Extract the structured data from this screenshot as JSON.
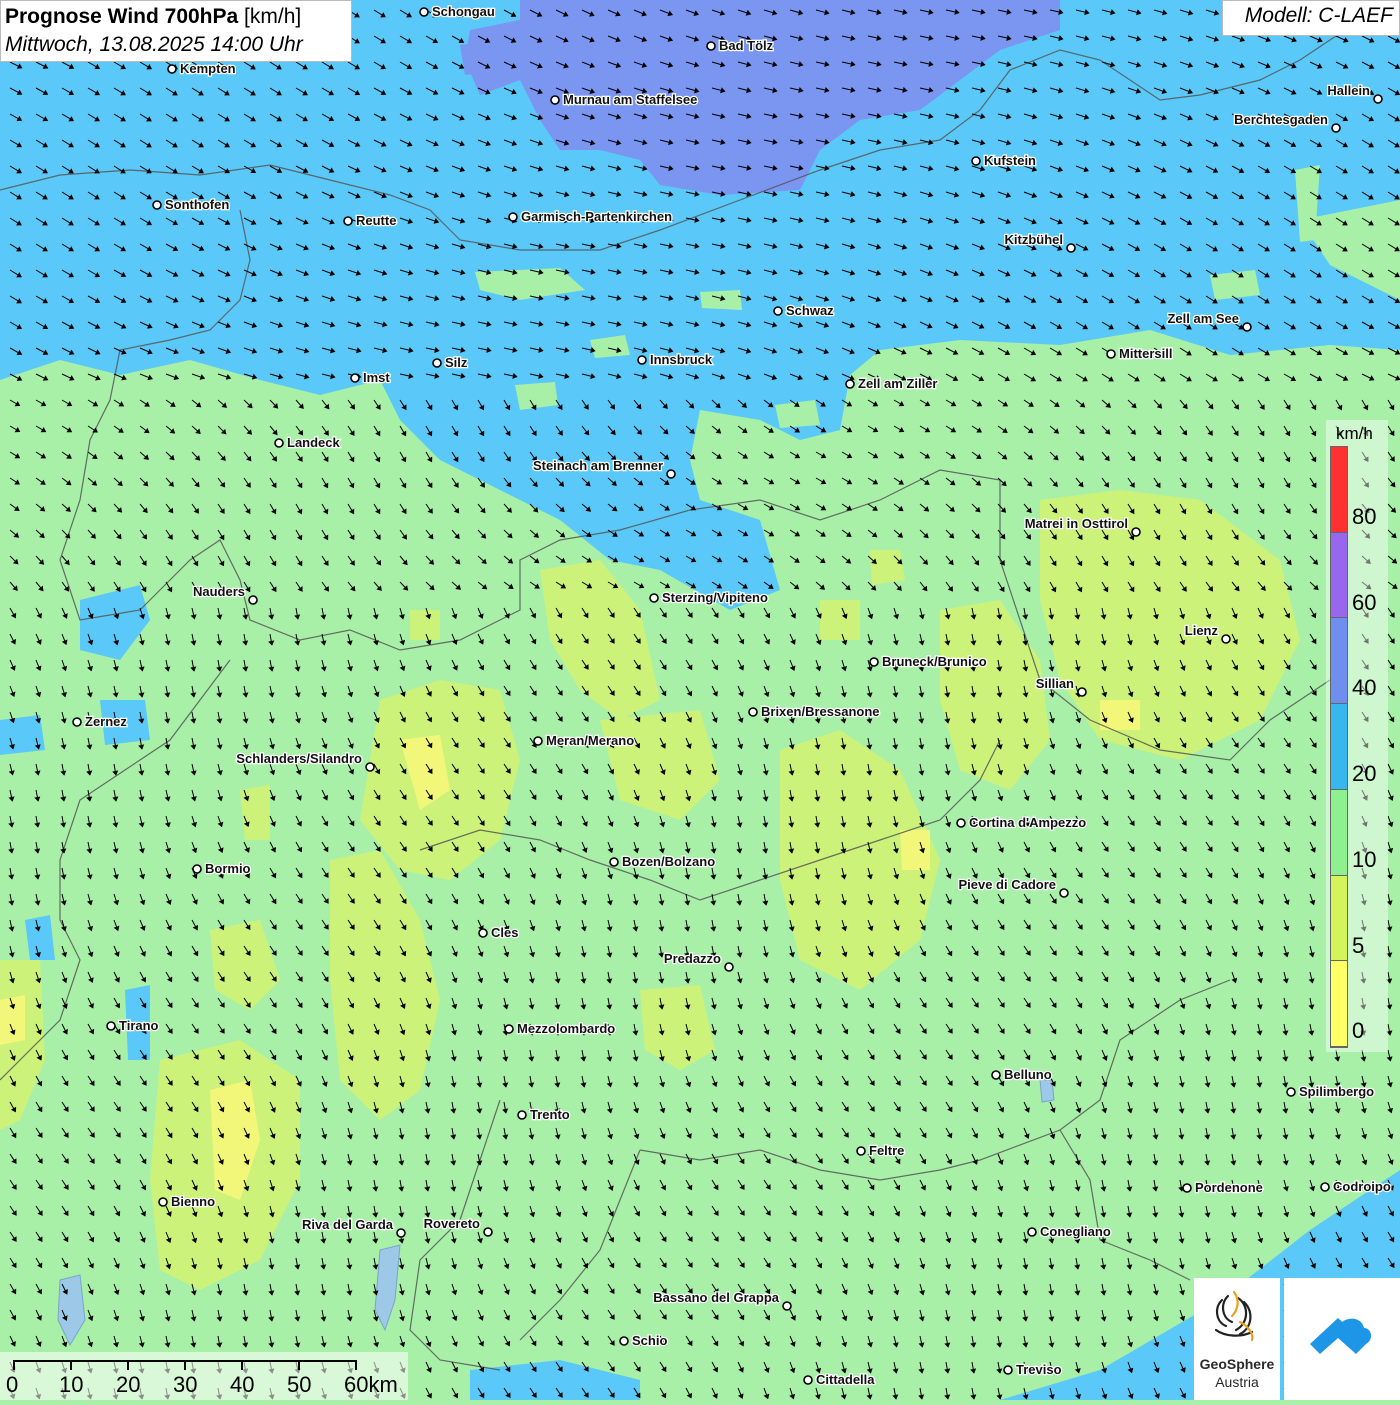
{
  "header": {
    "title_bold": "Prognose Wind 700hPa",
    "title_unit": "[km/h]",
    "subtitle": "Mittwoch, 13.08.2025 14:00 Uhr",
    "model": "Modell: C-LAEF"
  },
  "legend": {
    "unit": "km/h",
    "ticks": [
      "80",
      "60",
      "40",
      "20",
      "10",
      "5",
      "0"
    ],
    "colors": [
      "#ff3030",
      "#9966ee",
      "#6f8fee",
      "#38b6ee",
      "#8ff08f",
      "#d4f55a",
      "#ffff66"
    ]
  },
  "scale_bar": {
    "labels": [
      "0",
      "10",
      "20",
      "30",
      "40",
      "50",
      "60km"
    ]
  },
  "colors": {
    "speed_0_5": "#f2f77a",
    "speed_5_10": "#ccf27a",
    "speed_10_20": "#a8f0a8",
    "speed_20_40": "#5ac8f8",
    "speed_40_60": "#7a96f0",
    "arrow": "#000000",
    "border": "#555555"
  },
  "cities": [
    {
      "name": "Schongau"
    },
    {
      "name": "Bad Tölz"
    },
    {
      "name": "Kempten"
    },
    {
      "name": "Murnau am Staffelsee"
    },
    {
      "name": "Hallein"
    },
    {
      "name": "Berchtesgaden"
    },
    {
      "name": "Kufstein"
    },
    {
      "name": "Sonthofen"
    },
    {
      "name": "Reutte"
    },
    {
      "name": "Garmisch-Partenkirchen"
    },
    {
      "name": "Kitzbühel"
    },
    {
      "name": "Schwaz"
    },
    {
      "name": "Zell am See"
    },
    {
      "name": "Mittersill"
    },
    {
      "name": "Innsbruck"
    },
    {
      "name": "Imst"
    },
    {
      "name": "Silz"
    },
    {
      "name": "Zell am Ziller"
    },
    {
      "name": "Landeck"
    },
    {
      "name": "Steinach am Brenner"
    },
    {
      "name": "Matrei in Osttirol"
    },
    {
      "name": "Nauders"
    },
    {
      "name": "Sterzing/Vipiteno"
    },
    {
      "name": "Lienz"
    },
    {
      "name": "Bruneck/Brunico"
    },
    {
      "name": "Sillian"
    },
    {
      "name": "Zernez"
    },
    {
      "name": "Brixen/Bressanone"
    },
    {
      "name": "Meran/Merano"
    },
    {
      "name": "Schlanders/Silandro"
    },
    {
      "name": "Cortina d'Ampezzo"
    },
    {
      "name": "Bozen/Bolzano"
    },
    {
      "name": "Bormio"
    },
    {
      "name": "Pieve di Cadore"
    },
    {
      "name": "Cles"
    },
    {
      "name": "Predazzo"
    },
    {
      "name": "Tirano"
    },
    {
      "name": "Mezzolombardo"
    },
    {
      "name": "Belluno"
    },
    {
      "name": "Spilimbergo"
    },
    {
      "name": "Trento"
    },
    {
      "name": "Feltre"
    },
    {
      "name": "Pordenone"
    },
    {
      "name": "Codroipo"
    },
    {
      "name": "Bienno"
    },
    {
      "name": "Riva del Garda"
    },
    {
      "name": "Rovereto"
    },
    {
      "name": "Conegliano"
    },
    {
      "name": "Bassano del Grappa"
    },
    {
      "name": "Schio"
    },
    {
      "name": "Treviso"
    },
    {
      "name": "Cittadella"
    }
  ],
  "logos": {
    "geosphere_line1": "GeoSphere",
    "geosphere_line2": "Austria"
  }
}
